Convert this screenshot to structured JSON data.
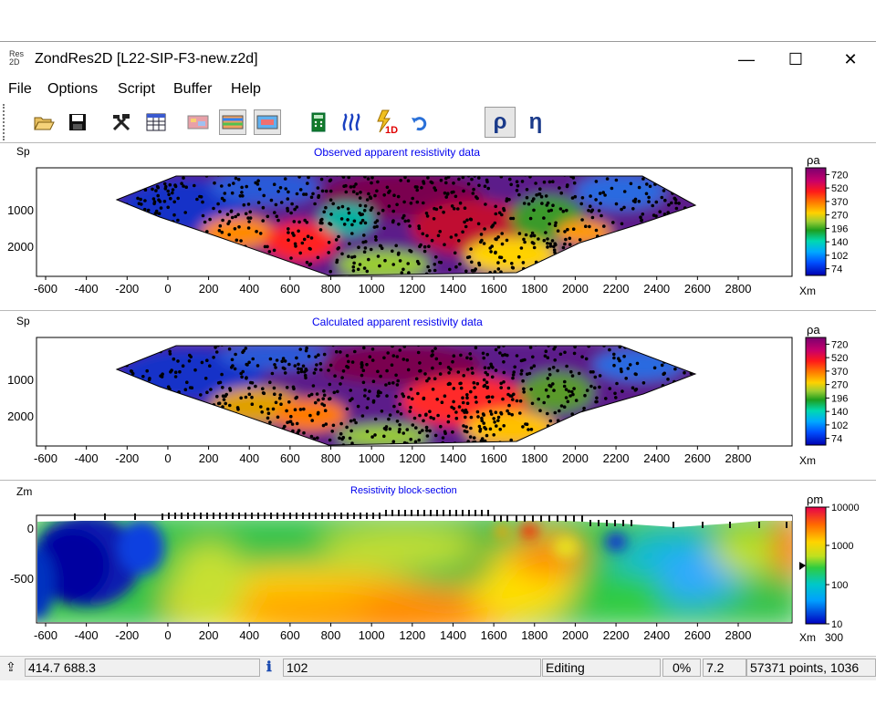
{
  "window": {
    "icon_text_top": "Res",
    "icon_text_bottom": "2D",
    "title": "ZondRes2D [L22-SIP-F3-new.z2d]",
    "minimize": "—",
    "maximize": "☐",
    "close": "✕"
  },
  "menu": [
    "File",
    "Options",
    "Script",
    "Buffer",
    "Help"
  ],
  "toolbar": {
    "buttons": [
      "open-folder-icon",
      "save-icon",
      "tools-icon",
      "table-icon",
      "model-view-icon",
      "section-view-icon",
      "pseudo-view-icon",
      "calculator-icon",
      "sounding-curves-icon",
      "inversion-1d-icon",
      "undo-icon",
      "rho-mode-button",
      "eta-mode-button"
    ],
    "rho_label": "ρ",
    "eta_label": "η"
  },
  "panels": {
    "observed": {
      "title": "Observed apparent resistivity data",
      "ylabel": "Sp",
      "xlabel": "Xm",
      "yticks": [
        "1000",
        "2000"
      ],
      "legend_label": "ρa",
      "legend_values": [
        "720",
        "520",
        "370",
        "270",
        "196",
        "140",
        "102",
        "74"
      ]
    },
    "calculated": {
      "title": "Calculated apparent resistivity data",
      "ylabel": "Sp",
      "xlabel": "Xm",
      "yticks": [
        "1000",
        "2000"
      ],
      "legend_label": "ρa",
      "legend_values": [
        "720",
        "520",
        "370",
        "270",
        "196",
        "140",
        "102",
        "74"
      ]
    },
    "section": {
      "title": "Resistivity block-section",
      "ylabel": "Zm",
      "xlabel": "Xm",
      "yticks": [
        "0",
        "-500"
      ],
      "legend_label": "ρm",
      "legend_values": [
        "10000",
        "1000",
        "100",
        "10"
      ],
      "legend_extra": "300"
    },
    "xticks": [
      "-600",
      "-400",
      "-200",
      "0",
      "200",
      "400",
      "600",
      "800",
      "1000",
      "1200",
      "1400",
      "1600",
      "1800",
      "2000",
      "2200",
      "2400",
      "2600",
      "2800"
    ]
  },
  "palette": {
    "apparent": [
      "#7a0070",
      "#c8006a",
      "#ff1a1a",
      "#ff7a00",
      "#ffd200",
      "#9acd32",
      "#1e9e1e",
      "#00d9b0",
      "#00aaff",
      "#0050ff",
      "#0000b0"
    ],
    "section": [
      "#e6004c",
      "#ff6a00",
      "#ffd400",
      "#c0e020",
      "#2ecc40",
      "#00c8c8",
      "#00a0ff",
      "#0000c0"
    ]
  },
  "status": {
    "coords": "414.7 688.3",
    "info_value": "102",
    "mode": "Editing",
    "percent": "0%",
    "rms": "7.2",
    "points": "57371 points,  1036"
  }
}
